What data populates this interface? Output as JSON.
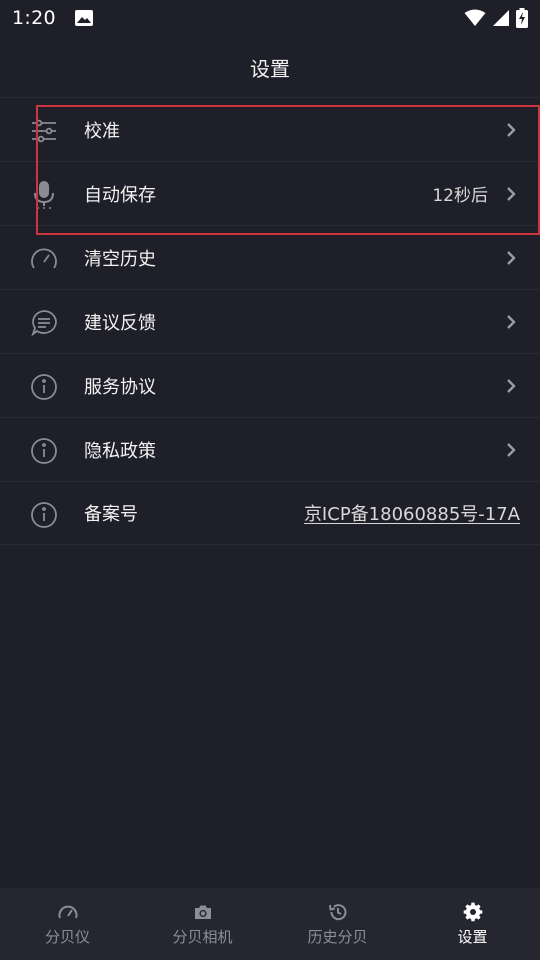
{
  "status_bar": {
    "time": "1:20",
    "icons": [
      "photo-icon",
      "wifi-icon",
      "signal-icon",
      "battery-charging-icon"
    ]
  },
  "header": {
    "title": "设置"
  },
  "settings": {
    "items": [
      {
        "label": "校准",
        "icon": "sliders-icon",
        "value": ""
      },
      {
        "label": "自动保存",
        "icon": "microphone-icon",
        "value": "12秒后"
      },
      {
        "label": "清空历史",
        "icon": "gauge-icon",
        "value": ""
      },
      {
        "label": "建议反馈",
        "icon": "chat-bubble-icon",
        "value": ""
      },
      {
        "label": "服务协议",
        "icon": "info-icon",
        "value": ""
      },
      {
        "label": "隐私政策",
        "icon": "info-icon",
        "value": ""
      },
      {
        "label": "备案号",
        "icon": "info-icon",
        "link": "京ICP备18060885号-17A"
      }
    ]
  },
  "tab_bar": {
    "tabs": [
      {
        "label": "分贝仪",
        "icon": "gauge-icon",
        "active": false
      },
      {
        "label": "分贝相机",
        "icon": "camera-icon",
        "active": false
      },
      {
        "label": "历史分贝",
        "icon": "history-icon",
        "active": false
      },
      {
        "label": "设置",
        "icon": "gear-icon",
        "active": true
      }
    ]
  },
  "colors": {
    "background": "#1e1f28",
    "tab_bar": "#252630",
    "highlight": "#d03440",
    "text": "#f2f2f2",
    "muted": "#8c8d96",
    "icon": "#8a8b94"
  }
}
